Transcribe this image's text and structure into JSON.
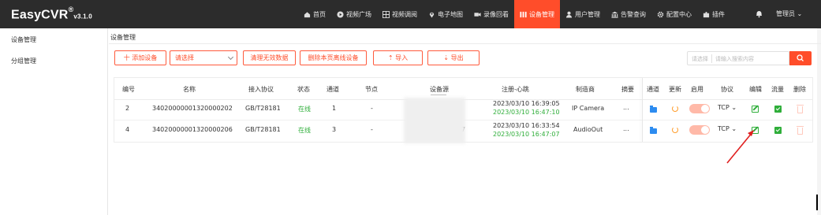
{
  "app": {
    "logo": "EasyCVR",
    "logo_reg": "®",
    "version": "v3.1.0"
  },
  "nav": [
    {
      "label": "首页",
      "icon": "home-icon"
    },
    {
      "label": "视频广场",
      "icon": "play-circle-icon"
    },
    {
      "label": "视频调阅",
      "icon": "grid-icon"
    },
    {
      "label": "电子地图",
      "icon": "map-pin-icon"
    },
    {
      "label": "录像回看",
      "icon": "video-camera-icon"
    },
    {
      "label": "设备管理",
      "icon": "bars-icon",
      "active": true
    },
    {
      "label": "用户管理",
      "icon": "user-icon"
    },
    {
      "label": "告警查询",
      "icon": "bank-icon"
    },
    {
      "label": "配置中心",
      "icon": "gear-icon"
    },
    {
      "label": "插件",
      "icon": "puzzle-icon"
    }
  ],
  "header": {
    "user": "管理员 ⌄",
    "bell_icon": "bell-icon"
  },
  "sidebar": {
    "items": [
      {
        "label": "设备管理"
      },
      {
        "label": "分组管理"
      }
    ]
  },
  "breadcrumb": "设备管理",
  "toolbar": {
    "add_label": "十 添加设备",
    "select_value": "请选择",
    "clear_label": "清理无效数据",
    "delete_offline_label": "删除本页离线设备",
    "import_label": "⇡ 导入",
    "export_label": "⇣ 导出",
    "search_type": "请选择",
    "search_placeholder": "请输入搜索内容",
    "search_icon": "search-icon"
  },
  "table": {
    "headers": [
      "编号",
      "名称",
      "接入协议",
      "状态",
      "通道",
      "节点",
      "设备源",
      "注册-心跳",
      "制造商",
      "摘要",
      "通道",
      "更新",
      "启用",
      "协议",
      "编辑",
      "流量",
      "删除"
    ],
    "rows": [
      {
        "id": "2",
        "name": "34020000001320000202",
        "protocol": "GB/T28181",
        "status": "在线",
        "channels": "1",
        "node": "-",
        "source": "",
        "register": "2023/03/10 16:39:05",
        "heartbeat": "2023/03/10 16:47:10",
        "maker": "IP Camera",
        "summary": "...",
        "proto_select": "TCP ⌄"
      },
      {
        "id": "4",
        "name": "34020000001320000206",
        "protocol": "GB/T28181",
        "status": "在线",
        "channels": "3",
        "node": "-",
        "source": "7",
        "register": "2023/03/10 16:33:54",
        "heartbeat": "2023/03/10 16:47:07",
        "maker": "AudioOut",
        "summary": "...",
        "proto_select": "TCP ⌄"
      }
    ]
  },
  "colors": {
    "accent": "#ff4d2a",
    "online": "#2fae3a",
    "topbar": "#2c2c2c",
    "annotation_arrow": "#e02020"
  }
}
